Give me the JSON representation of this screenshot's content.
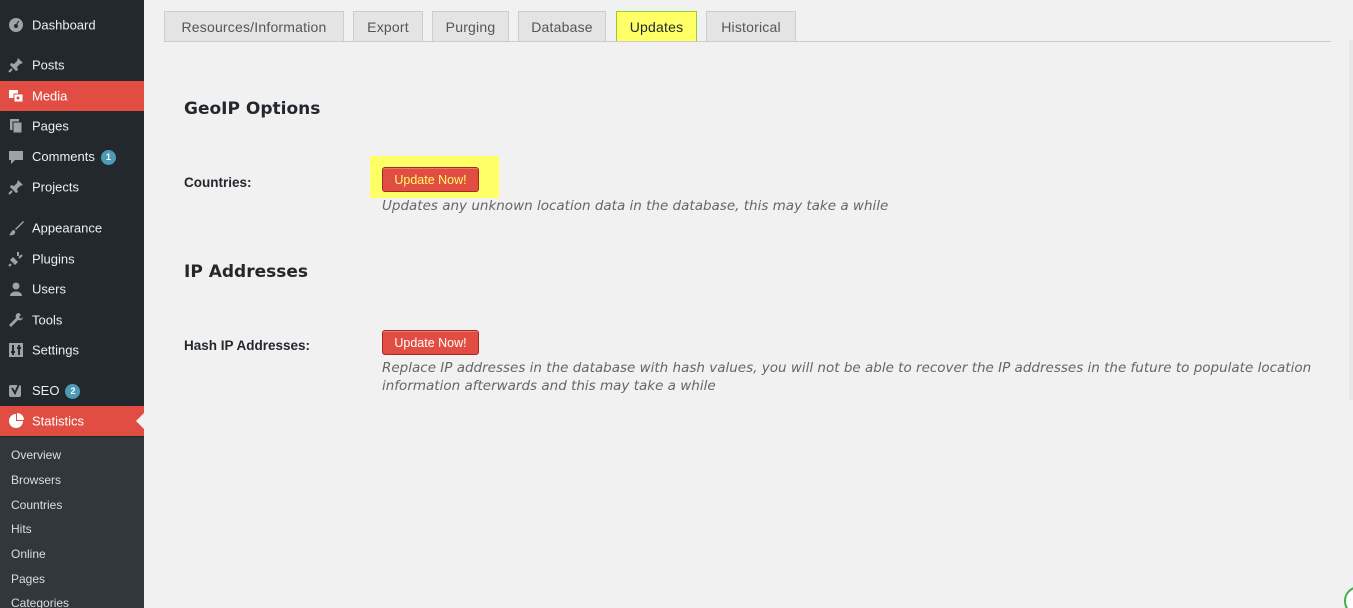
{
  "sidebar": {
    "items": [
      {
        "label": "Dashboard",
        "icon": "dashboard-icon"
      },
      {
        "label": "Posts",
        "icon": "pin-icon"
      },
      {
        "label": "Media",
        "icon": "media-icon"
      },
      {
        "label": "Pages",
        "icon": "pages-icon"
      },
      {
        "label": "Comments",
        "icon": "comment-icon",
        "badge": "1"
      },
      {
        "label": "Projects",
        "icon": "pin-icon"
      },
      {
        "label": "Appearance",
        "icon": "brush-icon"
      },
      {
        "label": "Plugins",
        "icon": "plug-icon"
      },
      {
        "label": "Users",
        "icon": "user-icon"
      },
      {
        "label": "Tools",
        "icon": "wrench-icon"
      },
      {
        "label": "Settings",
        "icon": "settings-icon"
      },
      {
        "label": "SEO",
        "icon": "seo-icon",
        "badge": "2"
      },
      {
        "label": "Statistics",
        "icon": "pie-chart-icon"
      }
    ],
    "submenu": [
      "Overview",
      "Browsers",
      "Countries",
      "Hits",
      "Online",
      "Pages",
      "Categories"
    ]
  },
  "tabs": [
    {
      "label": "Resources/Information"
    },
    {
      "label": "Export"
    },
    {
      "label": "Purging"
    },
    {
      "label": "Database"
    },
    {
      "label": "Updates"
    },
    {
      "label": "Historical"
    }
  ],
  "sections": {
    "geoip": {
      "title": "GeoIP Options",
      "field_label": "Countries:",
      "button_label": "Update Now!",
      "description": "Updates any unknown location data in the database, this may take a while"
    },
    "ip": {
      "title": "IP Addresses",
      "field_label": "Hash IP Addresses:",
      "button_label": "Update Now!",
      "description_line1": "Replace IP addresses in the database with hash values, you will not be able to recover the IP addresses in the future to populate location",
      "description_line2": "information afterwards and this may take a while"
    }
  },
  "colors": {
    "sidebar_bg": "#23282d",
    "accent_red": "#e14d43",
    "highlight_yellow": "#ffff66",
    "badge_blue": "#4b9bb5"
  }
}
